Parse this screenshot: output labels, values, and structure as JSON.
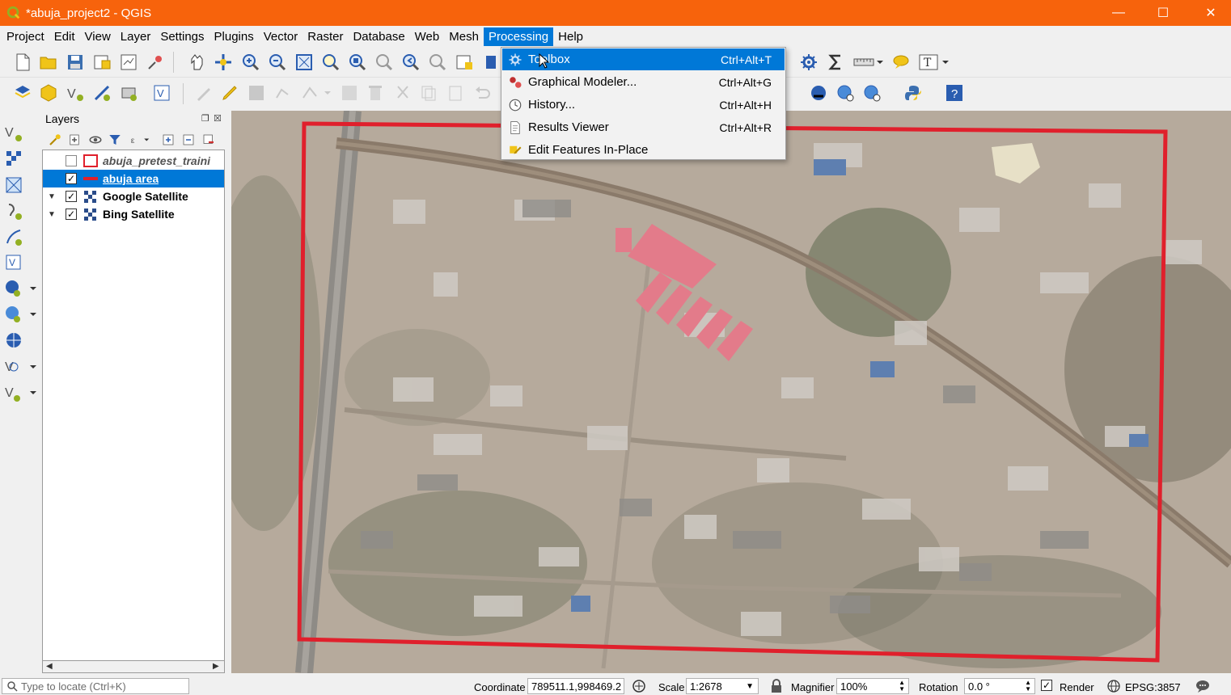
{
  "window": {
    "title": "*abuja_project2 - QGIS",
    "minimize": "—",
    "maximize": "☐",
    "close": "✕"
  },
  "menubar": {
    "items": [
      "Project",
      "Edit",
      "View",
      "Layer",
      "Settings",
      "Plugins",
      "Vector",
      "Raster",
      "Database",
      "Web",
      "Mesh",
      "Processing",
      "Help"
    ],
    "active": "Processing"
  },
  "processing_menu": {
    "items": [
      {
        "label": "Toolbox",
        "shortcut": "Ctrl+Alt+T",
        "icon": "gear-icon",
        "highlighted": true
      },
      {
        "label": "Graphical Modeler...",
        "shortcut": "Ctrl+Alt+G",
        "icon": "modeler-icon"
      },
      {
        "label": "History...",
        "shortcut": "Ctrl+Alt+H",
        "icon": "clock-icon"
      },
      {
        "label": "Results Viewer",
        "shortcut": "Ctrl+Alt+R",
        "icon": "document-icon"
      },
      {
        "label": "Edit Features In-Place",
        "shortcut": "",
        "icon": "edit-pencil-icon"
      }
    ]
  },
  "layers_panel": {
    "title": "Layers",
    "layers": [
      {
        "name": "abuja_pretest_traini",
        "checked": false,
        "symbol": "red-outline-polygon",
        "style": "italic"
      },
      {
        "name": "abuja area",
        "checked": true,
        "symbol": "red-line",
        "selected": true
      },
      {
        "name": "Google Satellite",
        "checked": true,
        "symbol": "raster-icon",
        "expandable": true
      },
      {
        "name": "Bing Satellite",
        "checked": true,
        "symbol": "raster-icon",
        "expandable": true
      }
    ]
  },
  "statusbar": {
    "locator_placeholder": "Type to locate (Ctrl+K)",
    "coordinate_label": "Coordinate",
    "coordinate_value": "789511.1,998469.2",
    "scale_label": "Scale",
    "scale_value": "1:2678",
    "magnifier_label": "Magnifier",
    "magnifier_value": "100%",
    "rotation_label": "Rotation",
    "rotation_value": "0.0 °",
    "render_label": "Render",
    "render_checked": true,
    "crs": "EPSG:3857"
  },
  "colors": {
    "titlebar": "#f7630c",
    "selection": "#0078d7",
    "boundary": "#e0202c"
  }
}
